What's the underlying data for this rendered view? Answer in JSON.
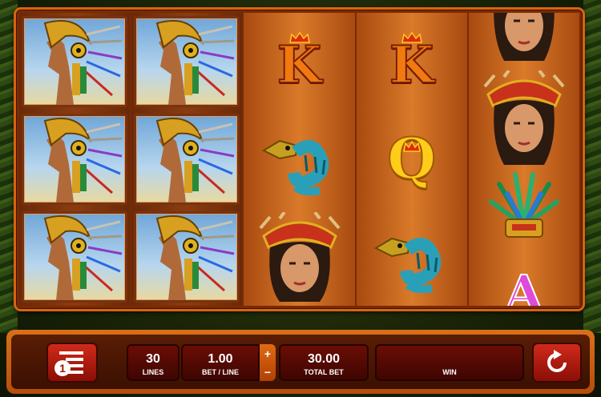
{
  "reels": {
    "reel1": [
      "warrior",
      "warrior",
      "warrior"
    ],
    "reel2": [
      "warrior",
      "warrior",
      "warrior"
    ],
    "reel3": [
      "K",
      "serpent",
      "priestess"
    ],
    "reel4": [
      "K",
      "Q",
      "serpent"
    ],
    "reel5": [
      "priestess",
      "priestess",
      "headdress",
      "A"
    ]
  },
  "symbols": {
    "k_label": "K",
    "q_label": "Q",
    "a_label": "A"
  },
  "controls": {
    "lines_value": "30",
    "lines_label": "LINES",
    "bet_line_value": "1.00",
    "bet_line_label": "BET / LINE",
    "plus_label": "+",
    "minus_label": "−",
    "total_bet_value": "30.00",
    "total_bet_label": "TOTAL BET",
    "win_value": "",
    "win_label": "WIN",
    "paytable_badge": "1"
  },
  "colors": {
    "frame": "#d9640f",
    "letter_k": "#f07a10",
    "letter_q": "#ffcc1a",
    "letter_a": "#e04ad8",
    "button_red": "#d02a1a"
  }
}
